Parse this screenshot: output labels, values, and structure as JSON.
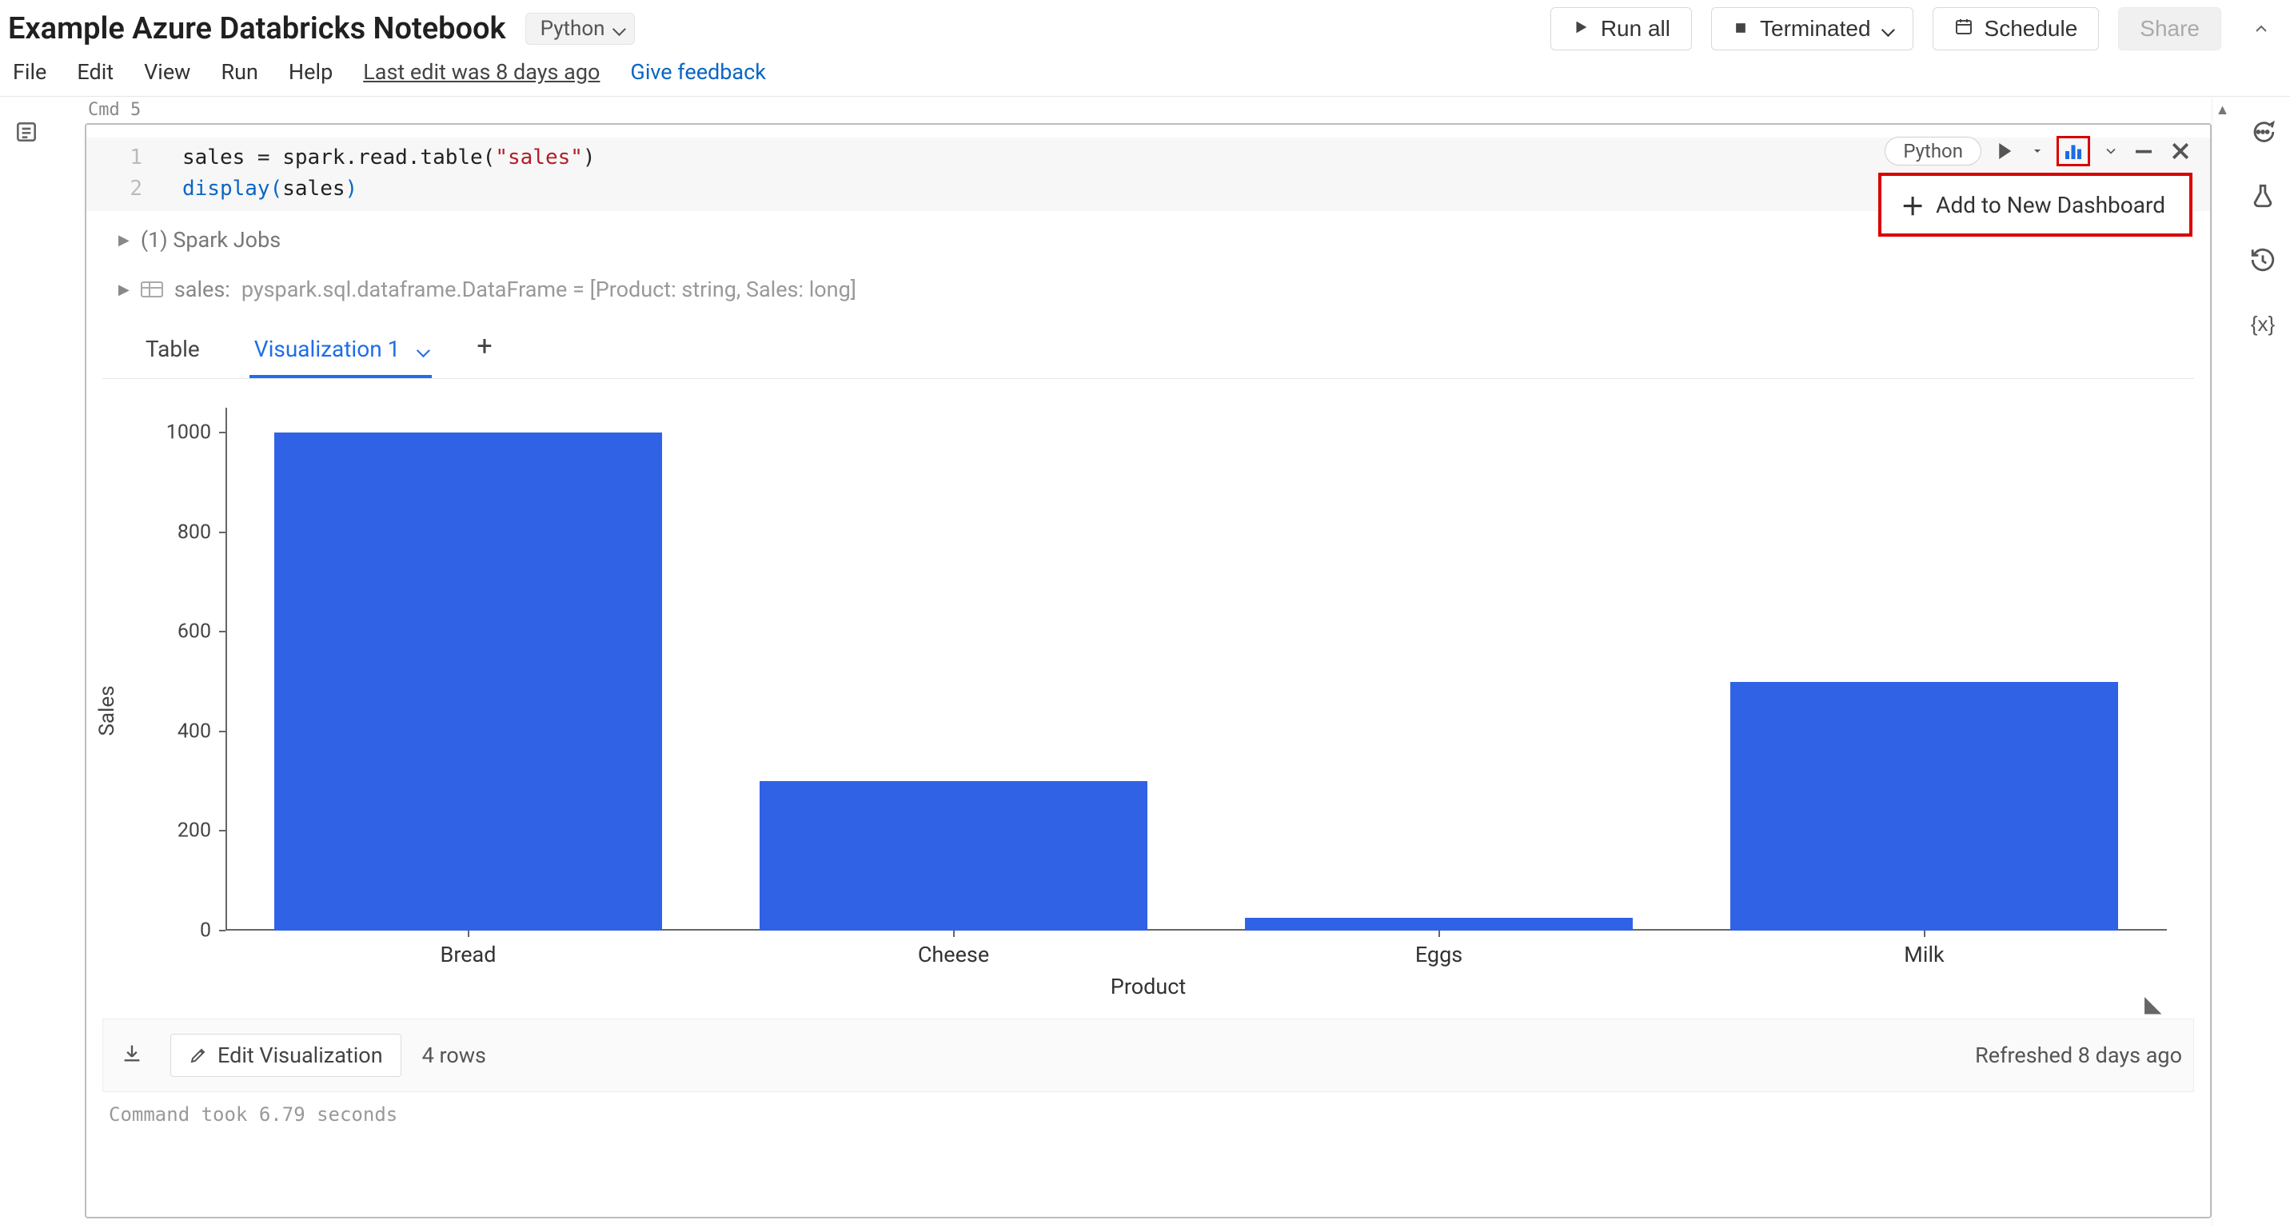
{
  "header": {
    "title": "Example Azure Databricks Notebook",
    "lang_label": "Python",
    "menu": {
      "file": "File",
      "edit": "Edit",
      "view": "View",
      "run": "Run",
      "help": "Help"
    },
    "last_edit": "Last edit was 8 days ago",
    "feedback": "Give feedback",
    "run_all": "Run all",
    "cluster_status": "Terminated",
    "schedule": "Schedule",
    "share": "Share"
  },
  "cell": {
    "cmd_label": "Cmd",
    "cmd_num": "5",
    "lang_pill": "Python",
    "add_dash": "Add to New Dashboard",
    "code": {
      "l1_left": "sales = spark.read.table(",
      "l1_str": "\"sales\"",
      "l1_right": ")",
      "l2_fn": "display",
      "l2_par_open": "(",
      "l2_arg": "sales",
      "l2_par_close": ")",
      "num1": "1",
      "num2": "2"
    },
    "spark_jobs": "(1) Spark Jobs",
    "df_name": "sales:",
    "df_schema": "pyspark.sql.dataframe.DataFrame = [Product: string, Sales: long]",
    "tabs": {
      "table": "Table",
      "viz": "Visualization 1"
    },
    "footer": {
      "edit": "Edit Visualization",
      "rows": "4 rows",
      "refreshed": "Refreshed 8 days ago"
    },
    "took": "Command took 6.79 seconds"
  },
  "chart_data": {
    "type": "bar",
    "categories": [
      "Bread",
      "Cheese",
      "Eggs",
      "Milk"
    ],
    "values": [
      1000,
      300,
      25,
      500
    ],
    "xlabel": "Product",
    "ylabel": "Sales",
    "y_ticks": [
      0,
      200,
      400,
      600,
      800,
      1000
    ],
    "ylim": [
      0,
      1050
    ]
  }
}
